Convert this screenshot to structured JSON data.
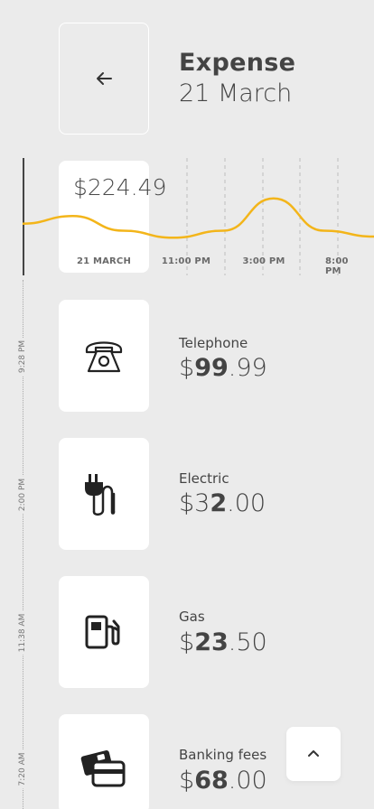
{
  "header": {
    "title": "Expense",
    "date": "21 March"
  },
  "chart_data": {
    "type": "line",
    "title": "",
    "total_label": "$224.49",
    "x_ticks": [
      "21 MARCH",
      "11:00 PM",
      "3:00 PM",
      "8:00 PM"
    ],
    "series": [
      {
        "values": [
          0.42,
          0.55,
          0.3,
          0.18,
          0.3,
          0.85,
          0.3,
          0.2
        ]
      }
    ],
    "line_color": "#f3b51a"
  },
  "expenses": [
    {
      "label": "Telephone",
      "amount_prefix": "$",
      "amount_bold": "99",
      "amount_cents": ".99",
      "time": "9:28 PM",
      "icon": "telephone-icon"
    },
    {
      "label": "Electric",
      "amount_prefix": "$3",
      "amount_bold": "2",
      "amount_cents": ".00",
      "time": "2:00 PM",
      "icon": "plug-icon"
    },
    {
      "label": "Gas",
      "amount_prefix": "$",
      "amount_bold": "23",
      "amount_cents": ".50",
      "time": "11:38 AM",
      "icon": "gas-pump-icon"
    },
    {
      "label": "Banking fees",
      "amount_prefix": "$",
      "amount_bold": "68",
      "amount_cents": ".00",
      "time": "7:20 AM",
      "icon": "credit-card-icon"
    }
  ],
  "colors": {
    "background": "#ebebeb",
    "card": "#ffffff",
    "accent": "#f3b51a",
    "text": "#444444"
  }
}
